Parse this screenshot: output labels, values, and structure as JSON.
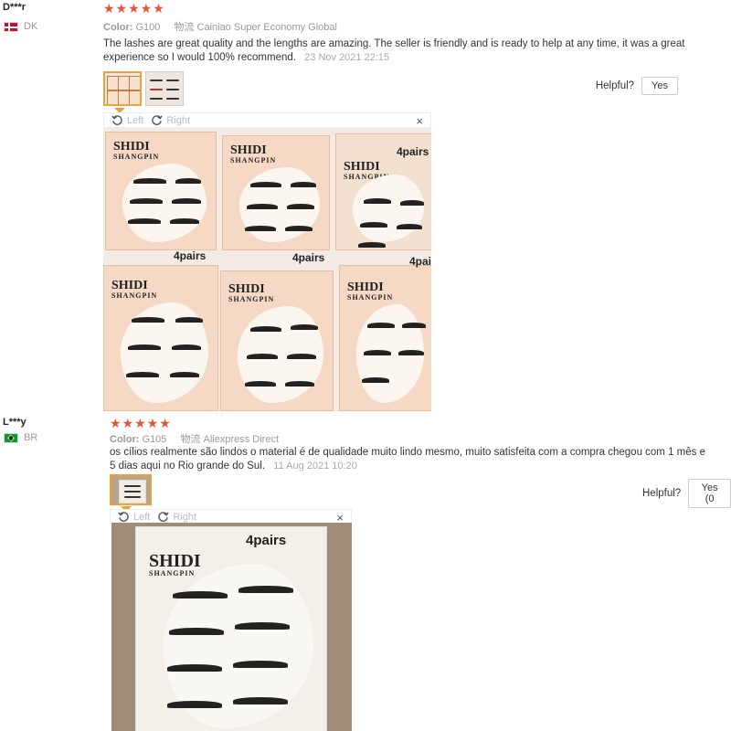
{
  "colors": {
    "star": "#e8533a",
    "accent": "#e8a33a"
  },
  "reviews": [
    {
      "user": "D***r",
      "country": "DK",
      "flag_icon": "flag-denmark-icon",
      "stars": "★★★★★",
      "color_label": "Color:",
      "color_value": "G100",
      "shipping_label": "物流",
      "shipping_value": "Cainiao Super Economy Global",
      "text": "The lashes are great quality and the lengths are amazing. The seller is friendly and is ready to help at any time, it was a great experience so I would 100% recommend.",
      "date": "23 Nov 2021 22:15",
      "helpful_label": "Helpful?",
      "yes_label": "Yes",
      "viewer": {
        "left": "Left",
        "right": "Right",
        "close": "×"
      },
      "photo_texts": {
        "brand": "SHIDI",
        "brand_sub": "SHANGPIN",
        "pairs": "4pairs"
      }
    },
    {
      "user": "L***y",
      "country": "BR",
      "flag_icon": "flag-brazil-icon",
      "stars": "★★★★★",
      "color_label": "Color:",
      "color_value": "G105",
      "shipping_label": "物流",
      "shipping_value": "Aliexpress Direct",
      "text": "os cílios realmente são lindos o material é de qualidade muito lindo mesmo, muito satisfeita com a compra chegou com 1 mês e 5 dias aqui no Rio grande do Sul.",
      "date": "11 Aug 2021 10:20",
      "helpful_label": "Helpful?",
      "yes_label": "Yes (0",
      "viewer": {
        "left": "Left",
        "right": "Right",
        "close": "×"
      },
      "photo_texts": {
        "brand": "SHIDI",
        "brand_sub": "SHANGPIN",
        "pairs": "4pairs"
      }
    }
  ]
}
